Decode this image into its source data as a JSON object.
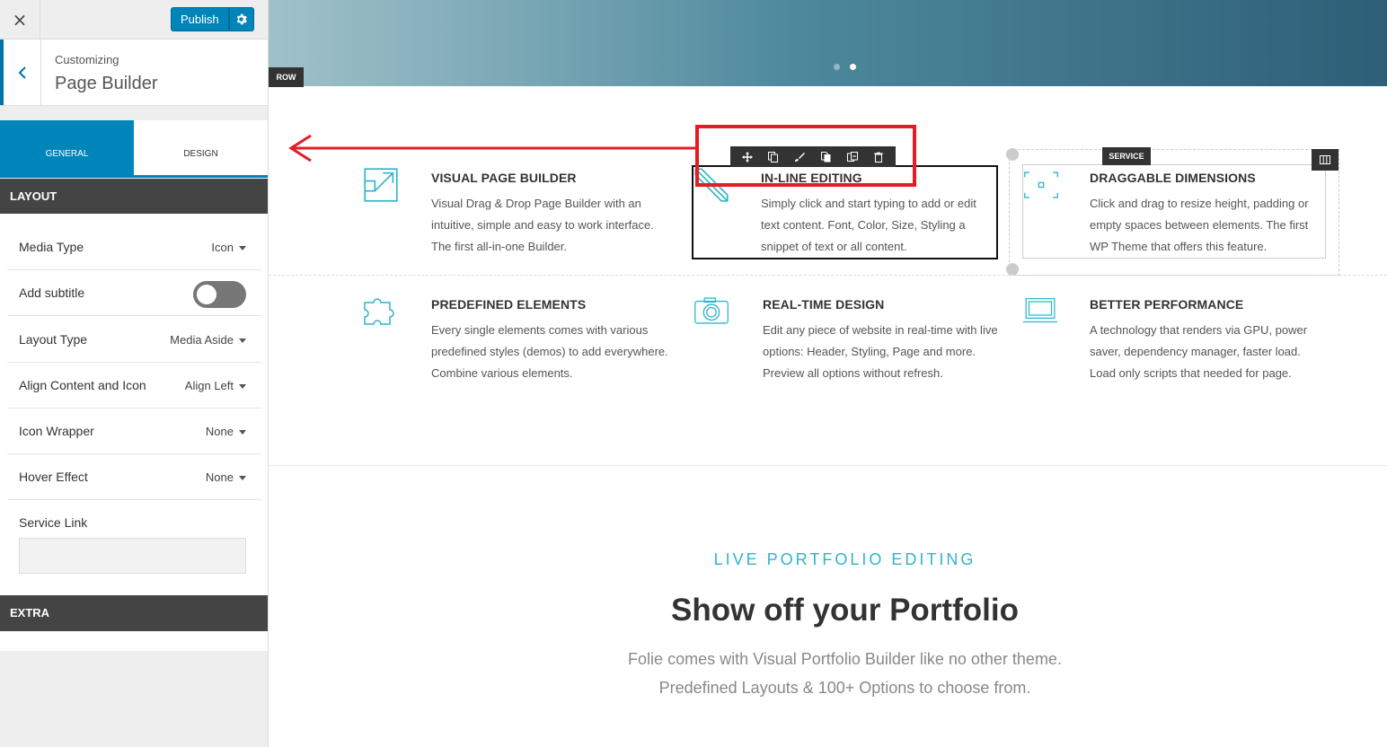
{
  "topbar": {
    "close_icon": "×",
    "publish_label": "Publish"
  },
  "crumb": {
    "small": "Customizing",
    "title": "Page Builder"
  },
  "tabs": [
    {
      "label": "General"
    },
    {
      "label": "Design"
    }
  ],
  "sections": {
    "layout": "LAYOUT",
    "extra": "EXTRA"
  },
  "settings": {
    "media_type": {
      "label": "Media Type",
      "value": "Icon"
    },
    "add_subtitle": {
      "label": "Add subtitle",
      "enabled": false
    },
    "layout_type": {
      "label": "Layout Type",
      "value": "Media Aside"
    },
    "align": {
      "label": "Align Content and Icon",
      "value": "Align Left"
    },
    "icon_wrapper": {
      "label": "Icon Wrapper",
      "value": "None"
    },
    "hover_effect": {
      "label": "Hover Effect",
      "value": "None"
    },
    "service_link": {
      "label": "Service Link",
      "value": ""
    }
  },
  "preview": {
    "row_tag": "ROW",
    "service_tag": "SERVICE",
    "slider_dots": [
      {
        "active": false
      },
      {
        "active": true
      }
    ],
    "colors": {
      "accent": "#2fb5c9",
      "publish": "#0085ba",
      "highlight": "#e51c23"
    },
    "features": [
      {
        "icon": "expand-icon",
        "title": "VISUAL PAGE BUILDER",
        "text": "Visual Drag & Drop Page Builder with an intuitive, simple and easy to work interface. The first all-in-one Builder."
      },
      {
        "icon": "pencil-icon",
        "title": "IN-LINE EDITING",
        "text": "Simply click  and start typing to add or edit text content. Font, Color, Size, Styling a snippet of text or all content."
      },
      {
        "icon": "resize-icon",
        "title": "DRAGGABLE DIMENSIONS",
        "text": "Click and drag to resize height, padding or empty spaces between elements. The first WP Theme that offers this feature."
      },
      {
        "icon": "puzzle-icon",
        "title": "PREDEFINED ELEMENTS",
        "text": "Every single elements comes with various predefined styles (demos) to add everywhere. Combine various elements."
      },
      {
        "icon": "camera-icon",
        "title": "REAL-TIME DESIGN",
        "text": "Edit any piece of website in real-time with live options: Header, Styling, Page and more. Preview all options without refresh."
      },
      {
        "icon": "laptop-icon",
        "title": "BETTER PERFORMANCE",
        "text": "A technology that renders via GPU, power saver, dependency manager, faster load. Load only scripts that needed for page."
      }
    ],
    "portfolio": {
      "subheading": "LIVE PORTFOLIO EDITING",
      "heading": "Show off your Portfolio",
      "desc_line1": "Folie comes with Visual Portfolio Builder like no other theme.",
      "desc_line2": "Predefined Layouts & 100+ Options to choose from."
    }
  }
}
